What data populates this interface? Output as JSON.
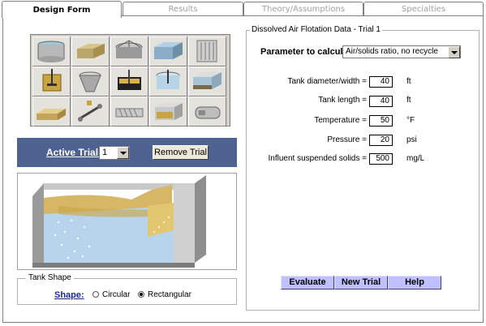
{
  "tabs": [
    {
      "label": "Design Form",
      "active": true
    },
    {
      "label": "Results",
      "active": false
    },
    {
      "label": "Theory/Assumptions",
      "active": false
    },
    {
      "label": "Specialties",
      "active": false
    }
  ],
  "process_icons": [
    "circular-clarifier-icon",
    "rectangular-basin-icon",
    "trickling-filter-icon",
    "aeration-tank-icon",
    "membrane-module-icon",
    "mixer-tank-icon",
    "grit-hopper-icon",
    "floc-tank-icon",
    "dissolved-air-flotation-icon",
    "filter-bed-icon",
    "sludge-drying-icon",
    "belt-press-icon",
    "screw-conveyor-icon",
    "gravity-thickener-icon",
    "centrifuge-icon"
  ],
  "trial": {
    "label": "Active Trial:",
    "value": "1",
    "remove_label": "Remove Trial"
  },
  "tank_shape": {
    "legend": "Tank Shape",
    "label": "Shape:",
    "options": [
      {
        "label": "Circular",
        "selected": false
      },
      {
        "label": "Rectangular",
        "selected": true
      }
    ]
  },
  "data": {
    "legend": "Dissolved Air Flotation Data - Trial 1",
    "param_label": "Parameter to calculate:",
    "param_value": "Air/solids ratio, no recycle",
    "fields": [
      {
        "label": "Tank diameter/width =",
        "value": "40",
        "unit": "ft"
      },
      {
        "label": "Tank length =",
        "value": "40",
        "unit": "ft"
      },
      {
        "label": "Temperature =",
        "value": "50",
        "unit": "°F"
      },
      {
        "label": "Pressure =",
        "value": "20",
        "unit": "psi"
      },
      {
        "label": "Influent suspended solids =",
        "value": "500",
        "unit": "mg/L"
      }
    ],
    "buttons": {
      "evaluate": "Evaluate",
      "new_trial": "New Trial",
      "help": "Help"
    }
  },
  "colors": {
    "trial_bar": "#4e6291",
    "action_button": "#c0c0ff",
    "shape_label": "#1e2a8a"
  }
}
